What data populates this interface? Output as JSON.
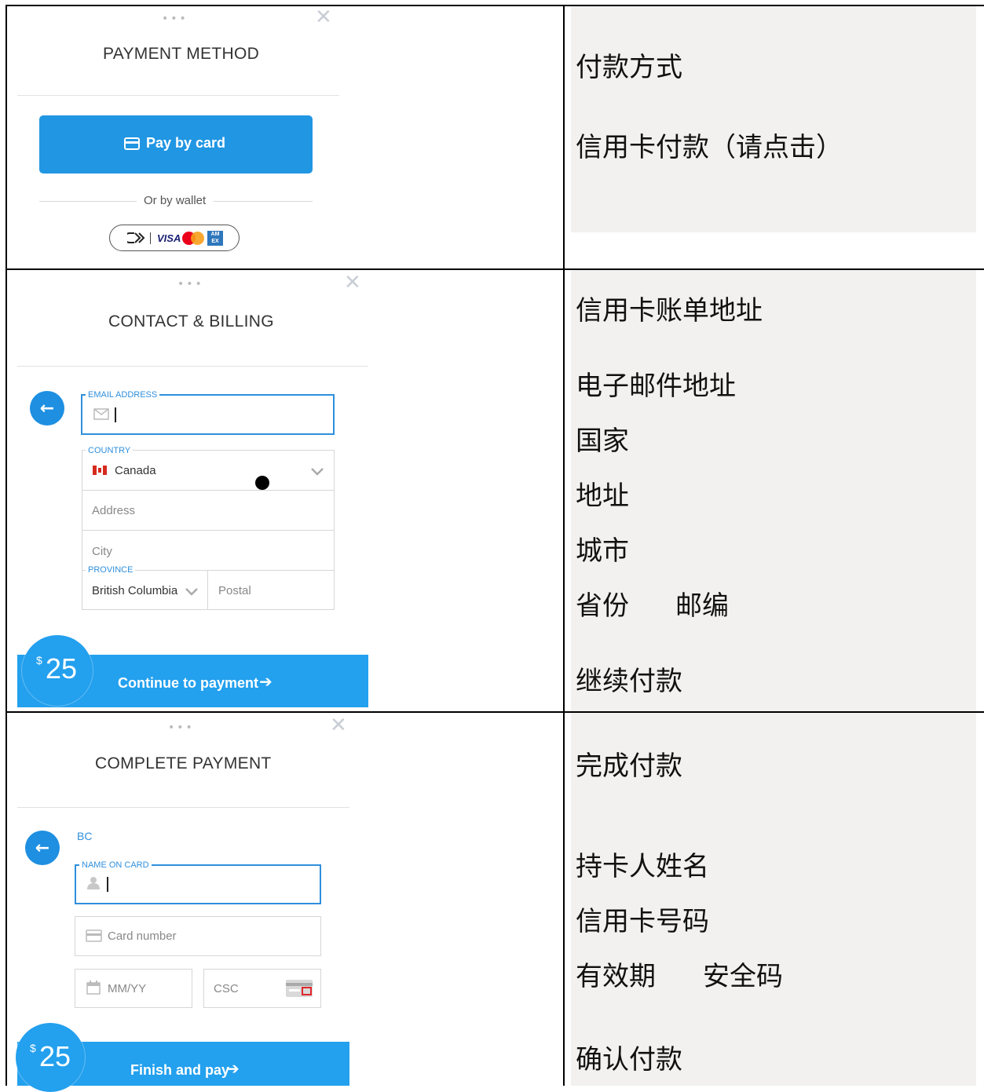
{
  "panel1": {
    "title": "PAYMENT METHOD",
    "pay_by_card": "Pay by card",
    "or_by_wallet": "Or by wallet",
    "wallet_visa": "VISA"
  },
  "panel1_zh": {
    "line1": "付款方式",
    "line2": "信用卡付款（请点击）"
  },
  "panel2": {
    "title": "CONTACT & BILLING",
    "email_label": "EMAIL ADDRESS",
    "country_label": "COUNTRY",
    "country_value": "Canada",
    "address_placeholder": "Address",
    "city_placeholder": "City",
    "province_label": "PROVINCE",
    "province_value": "British Columbia",
    "postal_placeholder": "Postal",
    "price_symbol": "$",
    "price": "25",
    "continue_label": "Continue to payment"
  },
  "panel2_zh": {
    "line1": "信用卡账单地址",
    "line2": "电子邮件地址",
    "line3": "国家",
    "line4": "地址",
    "line5": "城市",
    "line6a": "省份",
    "line6b": "邮编",
    "line7": "继续付款"
  },
  "panel3": {
    "title": "COMPLETE PAYMENT",
    "bc": "BC",
    "name_label": "NAME ON CARD",
    "card_number_placeholder": "Card number",
    "expiry_placeholder": "MM/YY",
    "csc_placeholder": "CSC",
    "price_symbol": "$",
    "price": "25",
    "finish_label": "Finish and pay"
  },
  "panel3_zh": {
    "line1": "完成付款",
    "line2": "持卡人姓名",
    "line3": "信用卡号码",
    "line4a": "有效期",
    "line4b": "安全码",
    "line5": "确认付款"
  }
}
